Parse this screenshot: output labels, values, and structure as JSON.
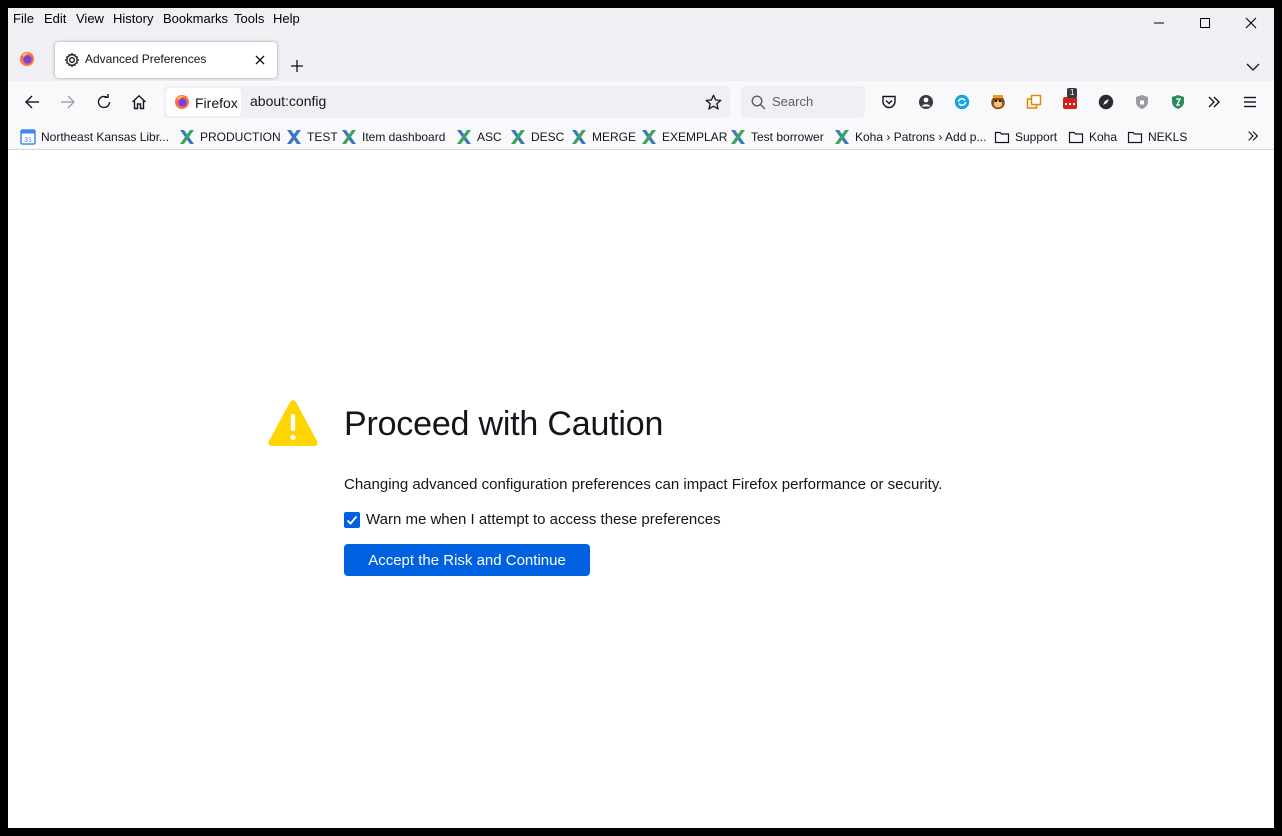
{
  "menubar": {
    "items": [
      "File",
      "Edit",
      "View",
      "History",
      "Bookmarks",
      "Tools",
      "Help"
    ]
  },
  "tab": {
    "title": "Advanced Preferences"
  },
  "navbar": {
    "identity_label": "Firefox",
    "url": "about:config",
    "search_placeholder": "Search",
    "badge_count": "1"
  },
  "bookmarks": [
    {
      "label": "Northeast Kansas Libr...",
      "icon": "calendar-icon"
    },
    {
      "label": "PRODUCTION",
      "icon": "koha-x-icon"
    },
    {
      "label": "TEST",
      "icon": "koha-x-icon"
    },
    {
      "label": "Item dashboard",
      "icon": "koha-x-icon"
    },
    {
      "label": "ASC",
      "icon": "koha-x-icon"
    },
    {
      "label": "DESC",
      "icon": "koha-x-icon"
    },
    {
      "label": "MERGE",
      "icon": "koha-x-icon"
    },
    {
      "label": "EXEMPLAR",
      "icon": "koha-x-icon"
    },
    {
      "label": "Test borrower",
      "icon": "koha-x-icon"
    },
    {
      "label": "Koha › Patrons › Add p...",
      "icon": "koha-x-icon"
    },
    {
      "label": "Support",
      "icon": "folder-icon"
    },
    {
      "label": "Koha",
      "icon": "folder-icon"
    },
    {
      "label": "NEKLS",
      "icon": "folder-icon"
    }
  ],
  "page": {
    "title": "Proceed with Caution",
    "description": "Changing advanced configuration preferences can impact Firefox performance or security.",
    "checkbox_label": "Warn me when I attempt to access these preferences",
    "checkbox_checked": true,
    "accept_button": "Accept the Risk and Continue"
  },
  "colors": {
    "accent": "#0061e0",
    "warning": "#ffd400"
  }
}
